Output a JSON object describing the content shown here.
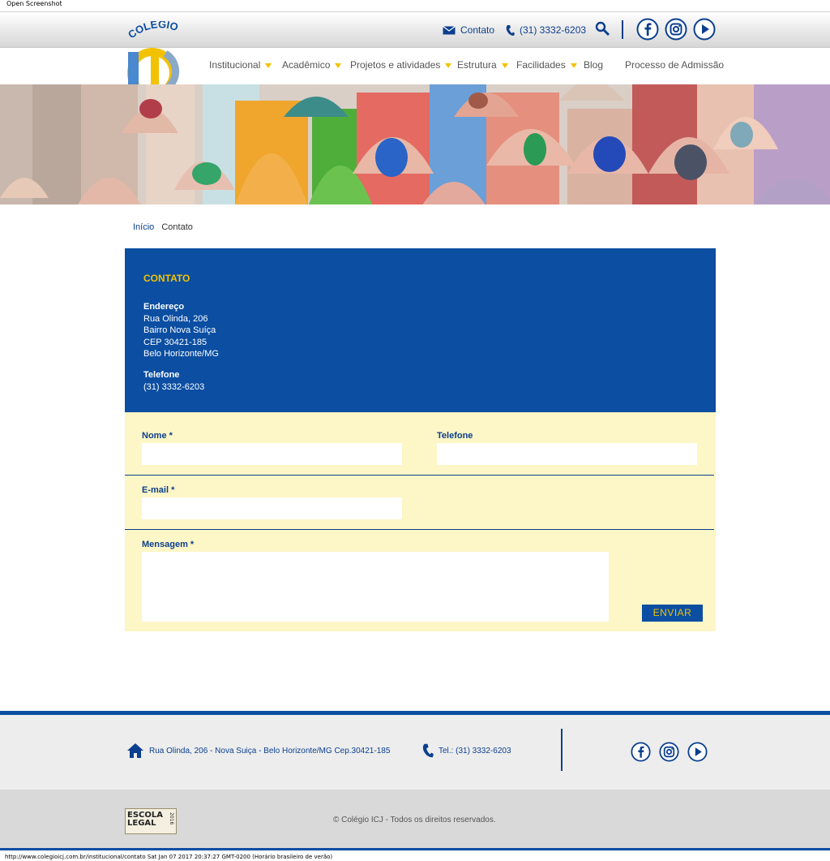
{
  "screenshot_label": "Open Screenshot",
  "header": {
    "contact_label": "Contato",
    "phone": "(31) 3332-6203",
    "logo_text": "COLÉGIO",
    "logo_monogram": "ICJ"
  },
  "menu": [
    {
      "label": "Institucional",
      "dropdown": true
    },
    {
      "label": "Acadêmico",
      "dropdown": true
    },
    {
      "label": "Projetos e atividades",
      "dropdown": true
    },
    {
      "label": "Estrutura",
      "dropdown": true
    },
    {
      "label": "Facilidades",
      "dropdown": true
    },
    {
      "label": "Blog",
      "dropdown": false
    },
    {
      "label": "Processo de Admissão",
      "dropdown": false
    }
  ],
  "breadcrumb": {
    "home": "Início",
    "current": "Contato"
  },
  "contact_info": {
    "title": "CONTATO",
    "address_title": "Endereço",
    "address_lines": [
      "Rua Olinda, 206",
      "Bairro Nova Suíça",
      "CEP 30421-185",
      "Belo Horizonte/MG"
    ],
    "phone_title": "Telefone",
    "phone": "(31) 3332-6203"
  },
  "form": {
    "name_label": "Nome *",
    "phone_label": "Telefone",
    "email_label": "E-mail *",
    "message_label": "Mensagem *",
    "name_value": "",
    "phone_value": "",
    "email_value": "",
    "message_value": "",
    "submit_label": "ENVIAR"
  },
  "footer": {
    "address": "Rua Olinda, 206 - Nova Suiça - Belo Horizonte/MG Cep.30421-185",
    "tel": "Tel.: (31) 3332-6203",
    "copyright": "© Colégio ICJ - Todos os direitos reservados.",
    "badge_line1": "ESCOLA",
    "badge_line2": "LEGAL",
    "badge_year": "2016"
  },
  "status_bar": "http://www.colegioicj.com.br/institucional/contato Sat Jan 07 2017 20:37:27 GMT-0200 (Horário brasileiro de verão)",
  "colors": {
    "primary_blue": "#0b4ea2",
    "accent_yellow": "#f2c200",
    "form_bg": "#fdf6c6"
  },
  "icons": [
    "mail-icon",
    "phone-icon",
    "search-icon",
    "facebook-icon",
    "instagram-icon",
    "youtube-icon",
    "home-icon"
  ]
}
